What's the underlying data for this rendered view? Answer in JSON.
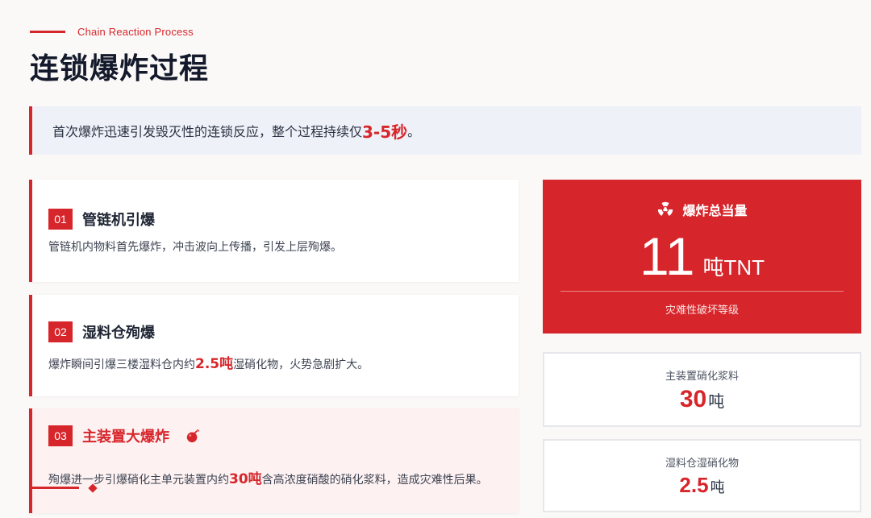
{
  "header": {
    "eyebrow": "Chain Reaction Process",
    "title": "连锁爆炸过程"
  },
  "banner": {
    "text_before": "首次爆炸迅速引发毁灭性的连锁反应，整个过程持续仅",
    "highlight": "3-5秒",
    "text_after": "。"
  },
  "steps": [
    {
      "number": "01",
      "title": "管链机引爆",
      "desc": "管链机内物料首先爆炸，冲击波向上传播，引发上层殉爆。"
    },
    {
      "number": "02",
      "title": "湿料仓殉爆",
      "desc_before": "爆炸瞬间引爆三楼湿料仓内约",
      "desc_highlight": "2.5吨",
      "desc_after": "湿硝化物，火势急剧扩大。"
    },
    {
      "number": "03",
      "title": "主装置大爆炸",
      "icon": "bomb-icon",
      "desc_before": "殉爆进一步引爆硝化主单元装置内约",
      "desc_highlight": "30吨",
      "desc_after": "含高浓度硝酸的硝化浆料，造成灾难性后果。"
    }
  ],
  "total": {
    "icon": "radiation-icon",
    "label": "爆炸总当量",
    "value": "11",
    "unit": "吨TNT",
    "note": "灾难性破坏等级"
  },
  "stats": [
    {
      "label": "主装置硝化浆料",
      "value": "30",
      "unit": "吨"
    },
    {
      "label": "湿料仓湿硝化物",
      "value": "2.5",
      "unit": "吨"
    }
  ],
  "colors": {
    "accent": "#d7262b",
    "background": "#faf9f8",
    "banner_bg": "#eef1f7",
    "step3_bg": "#fdf1f1"
  }
}
